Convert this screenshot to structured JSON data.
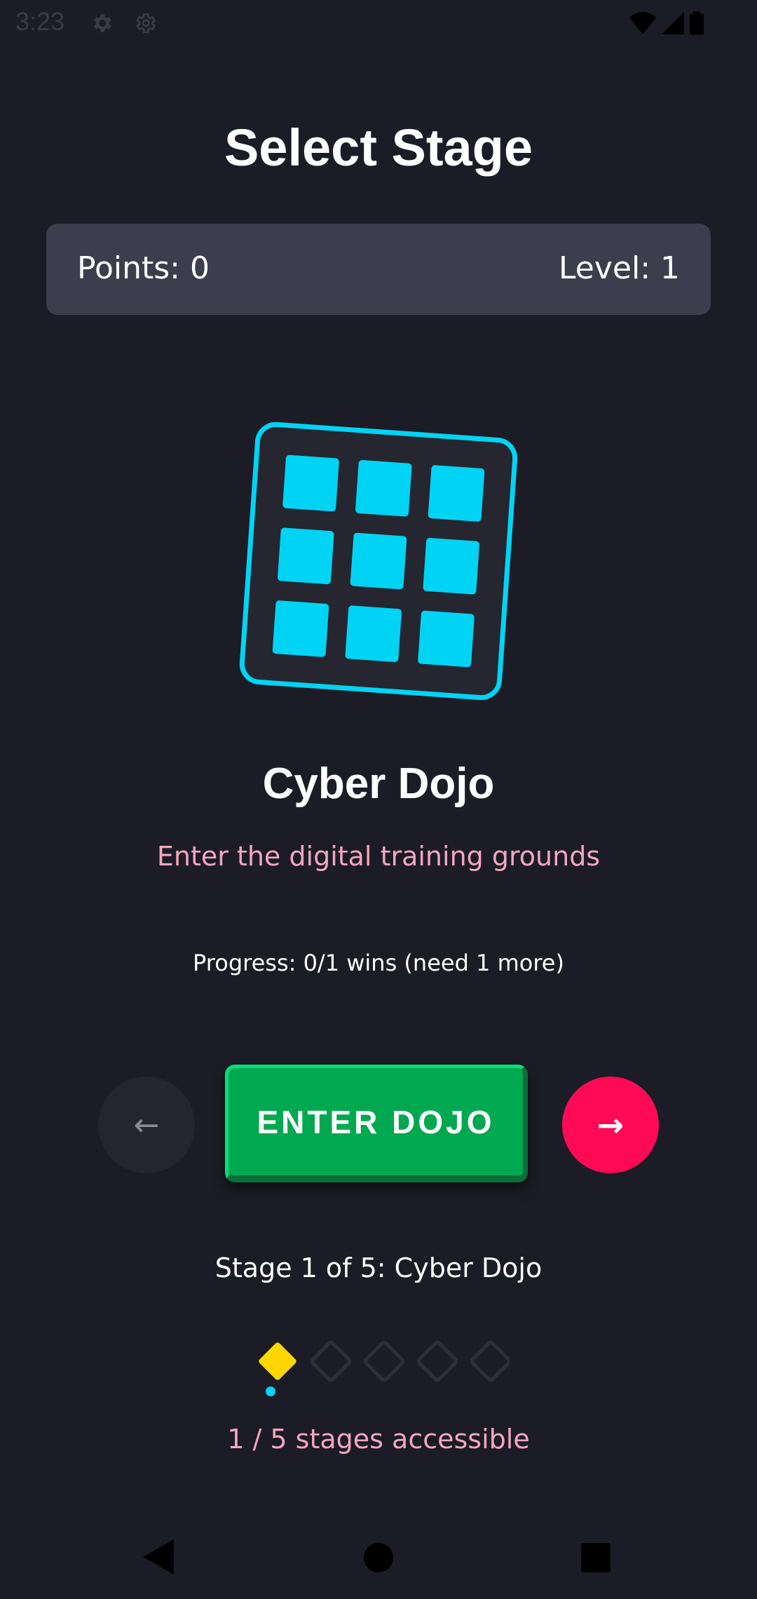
{
  "status_bar": {
    "time": "3:23",
    "left_icons": [
      "gear-icon",
      "gear-outline-icon"
    ],
    "right_icons": [
      "wifi-icon",
      "signal-icon",
      "battery-icon"
    ]
  },
  "header": {
    "title": "Select Stage"
  },
  "stats": {
    "points_label": "Points: 0",
    "level_label": "Level: 1"
  },
  "stage": {
    "icon": "grid-icon",
    "name": "Cyber Dojo",
    "description": "Enter the digital training grounds",
    "progress": "Progress: 0/1 wins (need 1 more)"
  },
  "controls": {
    "prev_glyph": "←",
    "enter_label": "ENTER DOJO",
    "next_glyph": "→"
  },
  "stage_counter": "Stage 1 of 5: Cyber Dojo",
  "stage_dots": {
    "total": 5,
    "current": 1
  },
  "accessible_text": "1 / 5 stages accessible",
  "colors": {
    "background": "#1b1c25",
    "accent_cyan": "#00d4f5",
    "accent_pink": "#ff0a54",
    "accent_green": "#00a94f",
    "accent_yellow": "#ffd700",
    "text_pink": "#f4a6bf"
  },
  "nav_bar": {
    "icons": [
      "back-icon",
      "home-icon",
      "recents-icon"
    ]
  }
}
